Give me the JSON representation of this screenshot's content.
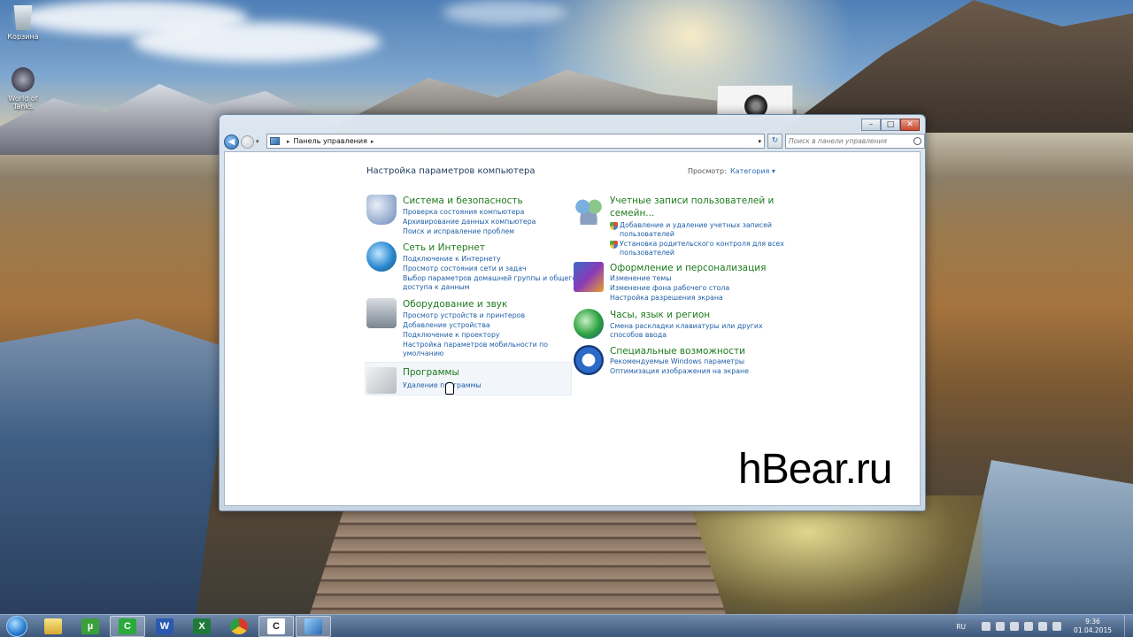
{
  "desktop": {
    "icons": [
      {
        "label": "Корзина"
      },
      {
        "label": "World of Tanks"
      }
    ]
  },
  "window": {
    "address": {
      "crumb": "Панель управления"
    },
    "search_placeholder": "Поиск в панели управления",
    "page_title": "Настройка параметров компьютера",
    "view_label": "Просмотр:",
    "view_value": "Категория ▾",
    "categories_left": [
      {
        "title": "Система и безопасность",
        "links": [
          "Проверка состояния компьютера",
          "Архивирование данных компьютера",
          "Поиск и исправление проблем"
        ]
      },
      {
        "title": "Сеть и Интернет",
        "links": [
          "Подключение к Интернету",
          "Просмотр состояния сети и задач",
          "Выбор параметров домашней группы и общего",
          "доступа к данным"
        ]
      },
      {
        "title": "Оборудование и звук",
        "links": [
          "Просмотр устройств и принтеров",
          "Добавление устройства",
          "Подключение к проектору",
          "Настройка параметров мобильности по",
          "умолчанию"
        ]
      },
      {
        "title": "Программы",
        "links": [
          "Удаление программы"
        ]
      }
    ],
    "categories_right": [
      {
        "title_line1": "Учетные записи пользователей и",
        "title_line2": "семейн...",
        "links": [
          "Добавление и удаление учетных записей",
          "пользователей",
          "Установка родительского контроля для всех",
          "пользователей"
        ]
      },
      {
        "title": "Оформление и персонализация",
        "links": [
          "Изменение темы",
          "Изменение фона рабочего стола",
          "Настройка разрешения экрана"
        ]
      },
      {
        "title": "Часы, язык и регион",
        "links": [
          "Смена раскладки клавиатуры или других",
          "способов ввода"
        ]
      },
      {
        "title": "Специальные возможности",
        "links": [
          "Рекомендуемые Windows параметры",
          "Оптимизация изображения на экране"
        ]
      }
    ]
  },
  "watermark": "hBear.ru",
  "taskbar": {
    "language": "RU",
    "time": "9:36",
    "date": "01.04.2015"
  }
}
